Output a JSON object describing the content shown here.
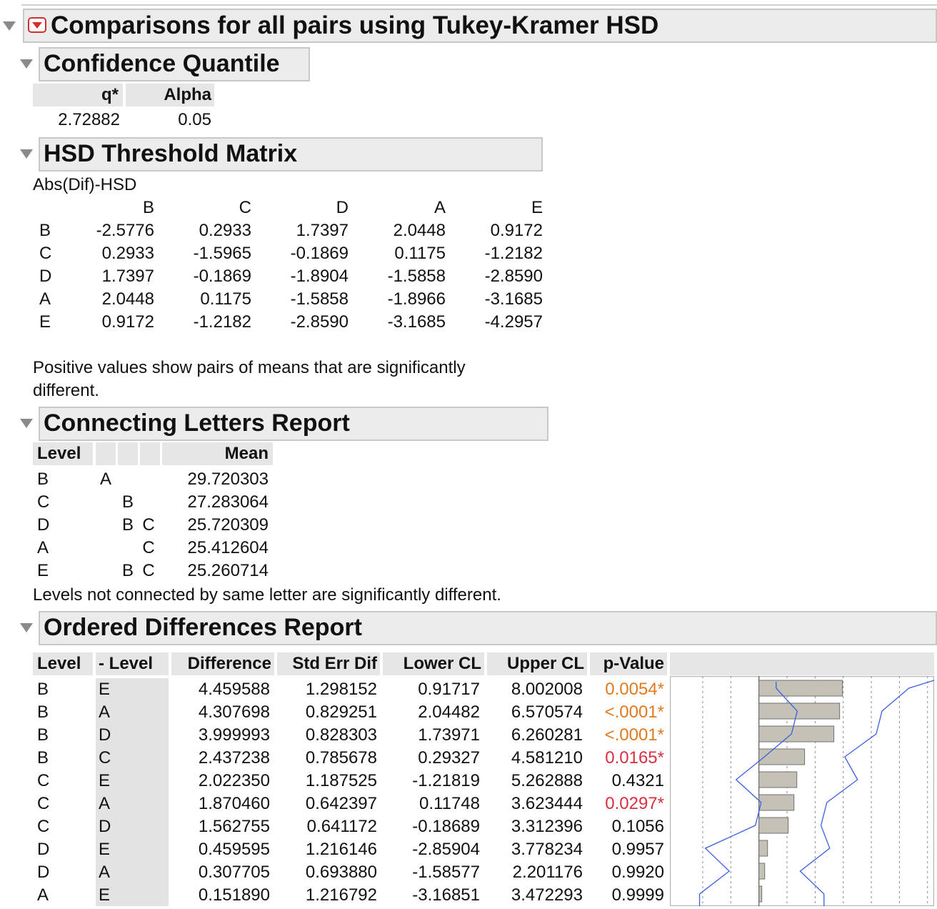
{
  "title": "Comparisons for all pairs using Tukey-Kramer HSD",
  "confidence_quantile": {
    "heading": "Confidence Quantile",
    "headers": [
      "q*",
      "Alpha"
    ],
    "values": [
      "2.72882",
      "0.05"
    ]
  },
  "hsd_matrix": {
    "heading": "HSD Threshold Matrix",
    "subtitle": "Abs(Dif)-HSD",
    "columns": [
      "B",
      "C",
      "D",
      "A",
      "E"
    ],
    "rows": [
      {
        "label": "B",
        "cells": [
          "-2.5776",
          "0.2933",
          "1.7397",
          "2.0448",
          "0.9172"
        ]
      },
      {
        "label": "C",
        "cells": [
          "0.2933",
          "-1.5965",
          "-0.1869",
          "0.1175",
          "-1.2182"
        ]
      },
      {
        "label": "D",
        "cells": [
          "1.7397",
          "-0.1869",
          "-1.8904",
          "-1.5858",
          "-2.8590"
        ]
      },
      {
        "label": "A",
        "cells": [
          "2.0448",
          "0.1175",
          "-1.5858",
          "-1.8966",
          "-3.1685"
        ]
      },
      {
        "label": "E",
        "cells": [
          "0.9172",
          "-1.2182",
          "-2.8590",
          "-3.1685",
          "-4.2957"
        ]
      }
    ],
    "note_line1": "Positive values show pairs of means that are significantly",
    "note_line2": "different."
  },
  "connecting_letters": {
    "heading": "Connecting Letters Report",
    "headers": {
      "level": "Level",
      "mean": "Mean"
    },
    "rows": [
      {
        "level": "B",
        "l1": "A",
        "l2": "",
        "l3": "",
        "mean": "29.720303"
      },
      {
        "level": "C",
        "l1": "",
        "l2": "B",
        "l3": "",
        "mean": "27.283064"
      },
      {
        "level": "D",
        "l1": "",
        "l2": "B",
        "l3": "C",
        "mean": "25.720309"
      },
      {
        "level": "A",
        "l1": "",
        "l2": "",
        "l3": "C",
        "mean": "25.412604"
      },
      {
        "level": "E",
        "l1": "",
        "l2": "B",
        "l3": "C",
        "mean": "25.260714"
      }
    ],
    "note": "Levels not connected by same letter are significantly different."
  },
  "ordered_differences": {
    "heading": "Ordered Differences Report",
    "headers": [
      "Level",
      "- Level",
      "Difference",
      "Std Err Dif",
      "Lower CL",
      "Upper CL",
      "p-Value"
    ],
    "rows": [
      {
        "level": "B",
        "minus": "E",
        "diff": "4.459588",
        "se": "1.298152",
        "lcl": "0.91717",
        "ucl": "8.002008",
        "p": "0.0054*",
        "pclass": "orange",
        "d": 4.459588
      },
      {
        "level": "B",
        "minus": "A",
        "diff": "4.307698",
        "se": "0.829251",
        "lcl": "2.04482",
        "ucl": "6.570574",
        "p": "<.0001*",
        "pclass": "orange",
        "d": 4.307698
      },
      {
        "level": "B",
        "minus": "D",
        "diff": "3.999993",
        "se": "0.828303",
        "lcl": "1.73971",
        "ucl": "6.260281",
        "p": "<.0001*",
        "pclass": "orange",
        "d": 3.999993
      },
      {
        "level": "B",
        "minus": "C",
        "diff": "2.437238",
        "se": "0.785678",
        "lcl": "0.29327",
        "ucl": "4.581210",
        "p": "0.0165*",
        "pclass": "red",
        "d": 2.437238
      },
      {
        "level": "C",
        "minus": "E",
        "diff": "2.022350",
        "se": "1.187525",
        "lcl": "-1.21819",
        "ucl": "5.262888",
        "p": "0.4321",
        "pclass": "",
        "d": 2.02235
      },
      {
        "level": "C",
        "minus": "A",
        "diff": "1.870460",
        "se": "0.642397",
        "lcl": "0.11748",
        "ucl": "3.623444",
        "p": "0.0297*",
        "pclass": "red",
        "d": 1.87046
      },
      {
        "level": "C",
        "minus": "D",
        "diff": "1.562755",
        "se": "0.641172",
        "lcl": "-0.18689",
        "ucl": "3.312396",
        "p": "0.1056",
        "pclass": "",
        "d": 1.562755
      },
      {
        "level": "D",
        "minus": "E",
        "diff": "0.459595",
        "se": "1.216146",
        "lcl": "-2.85904",
        "ucl": "3.778234",
        "p": "0.9957",
        "pclass": "",
        "d": 0.459595
      },
      {
        "level": "D",
        "minus": "A",
        "diff": "0.307705",
        "se": "0.693880",
        "lcl": "-1.58577",
        "ucl": "2.201176",
        "p": "0.9920",
        "pclass": "",
        "d": 0.307705
      },
      {
        "level": "A",
        "minus": "E",
        "diff": "0.151890",
        "se": "1.216792",
        "lcl": "-3.16851",
        "ucl": "3.472293",
        "p": "0.9999",
        "pclass": "",
        "d": 0.15189
      }
    ]
  },
  "colors": {
    "orange": "#e07a1f",
    "red": "#d63040",
    "bar": "#c4c2b6",
    "ci_line": "#3a5fe0"
  }
}
